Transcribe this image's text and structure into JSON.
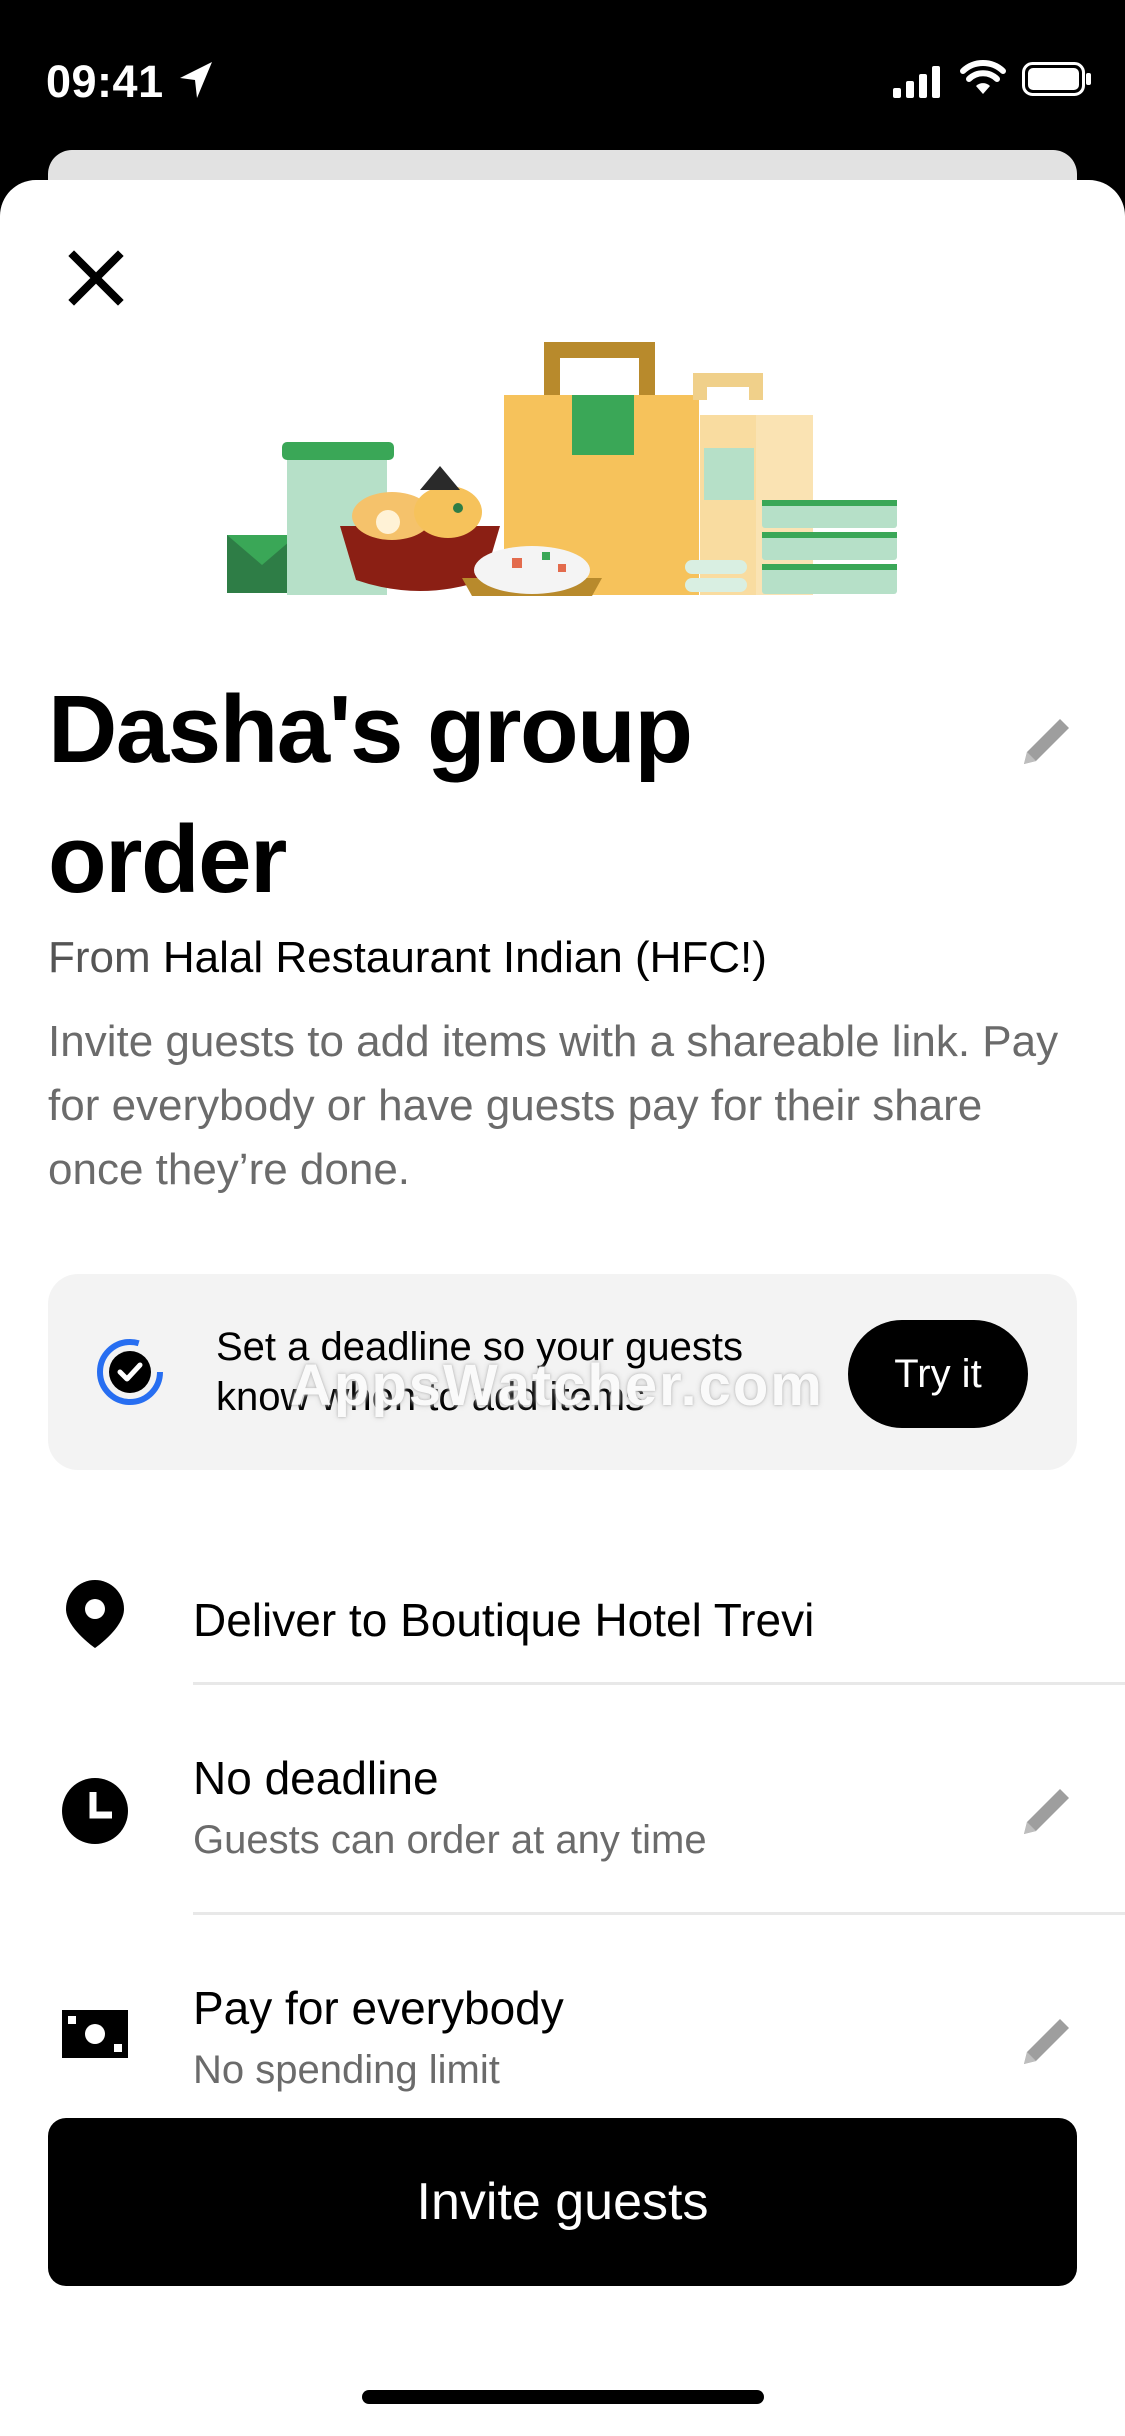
{
  "status_bar": {
    "time": "09:41"
  },
  "header": {
    "close_icon": "close-icon"
  },
  "order": {
    "title": "Dasha's group order",
    "from_prefix": "From",
    "restaurant": "Halal Restaurant Indian (HFC!)",
    "description": "Invite guests to add items with a shareable link. Pay for everybody or have guests pay for their share once they’re done."
  },
  "watermark": "AppsWatcher.com",
  "promo": {
    "text": "Set a deadline so your guests know when to add items",
    "button_label": "Try it"
  },
  "settings": {
    "delivery": {
      "title": "Deliver to Boutique Hotel Trevi",
      "icon": "location-pin-icon"
    },
    "deadline": {
      "title": "No deadline",
      "subtitle": "Guests can order at any time",
      "icon": "clock-icon"
    },
    "payment": {
      "title": "Pay for everybody",
      "subtitle": "No spending limit",
      "icon": "cash-icon"
    }
  },
  "footer": {
    "invite_label": "Invite guests"
  },
  "colors": {
    "primary": "#000000",
    "background": "#ffffff",
    "promo_bg": "#f3f3f3",
    "muted_text": "#6b6b6b",
    "accent_blue": "#276ef1",
    "illustration_green": "#3aa757",
    "illustration_yellow": "#f6c25b"
  }
}
